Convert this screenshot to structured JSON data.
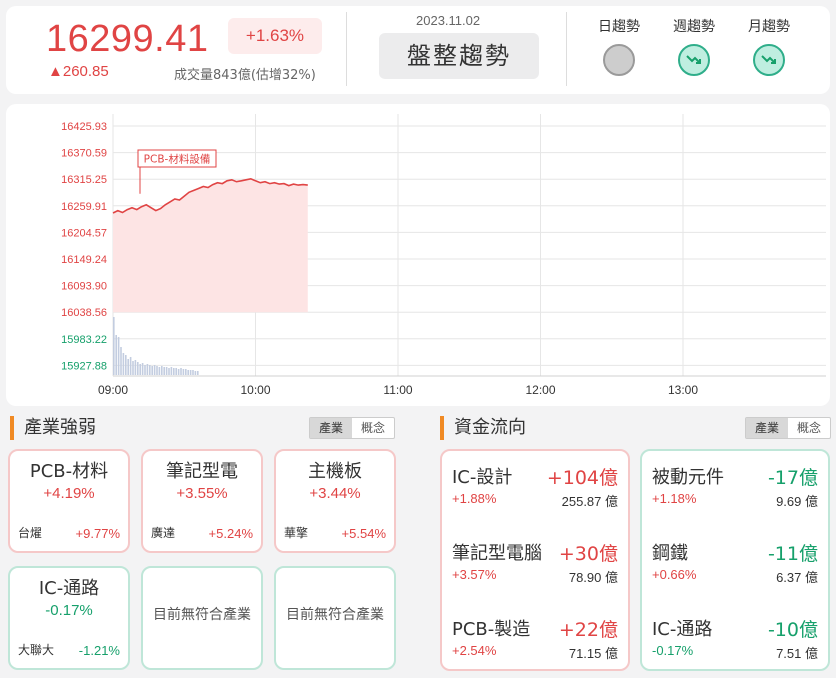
{
  "header": {
    "index_value": "16299.41",
    "pct_change": "+1.63%",
    "point_change": "▲260.85",
    "volume": "成交量843億(估增32%)",
    "date": "2023.11.02",
    "trend_label": "盤整趨勢",
    "trends": [
      {
        "label": "日趨勢",
        "state": "neutral",
        "icon": "neutral-circle-icon"
      },
      {
        "label": "週趨勢",
        "state": "down",
        "icon": "trend-down-icon"
      },
      {
        "label": "月趨勢",
        "state": "down",
        "icon": "trend-down-icon"
      }
    ]
  },
  "chart_data": {
    "type": "line",
    "y_ticks": [
      "16425.93",
      "16370.59",
      "16315.25",
      "16259.91",
      "16204.57",
      "16149.24",
      "16093.90",
      "16038.56",
      "15983.22",
      "15927.88"
    ],
    "y_tick_colors": [
      "#e04444",
      "#e04444",
      "#e04444",
      "#e04444",
      "#e04444",
      "#e04444",
      "#e04444",
      "#e04444",
      "#16a06b",
      "#16a06b"
    ],
    "x_ticks": [
      "09:00",
      "10:00",
      "11:00",
      "12:00",
      "13:00"
    ],
    "ylim": [
      15927.88,
      16425.93
    ],
    "x_range_minutes": [
      0,
      300
    ],
    "annotation": "PCB-材料設備",
    "price_series": {
      "minutes": [
        0,
        2,
        4,
        6,
        8,
        10,
        12,
        14,
        16,
        18,
        20,
        22,
        24,
        26,
        28,
        30,
        32,
        34,
        36,
        38,
        40,
        42,
        44,
        46,
        48,
        50,
        52,
        54,
        56,
        58,
        60,
        62,
        64,
        66,
        68,
        70,
        72,
        74,
        76,
        78,
        80,
        82
      ],
      "values": [
        16245,
        16250,
        16246,
        16252,
        16256,
        16252,
        16258,
        16262,
        16256,
        16250,
        16254,
        16262,
        16268,
        16274,
        16272,
        16280,
        16288,
        16292,
        16296,
        16300,
        16298,
        16304,
        16308,
        16306,
        16312,
        16314,
        16310,
        16312,
        16314,
        16316,
        16312,
        16308,
        16310,
        16306,
        16308,
        16305,
        16306,
        16302,
        16305,
        16303,
        16304,
        16303
      ]
    },
    "volume_bars": [
      58,
      40,
      38,
      28,
      22,
      20,
      16,
      18,
      14,
      15,
      13,
      11,
      12,
      10,
      11,
      10,
      9,
      10,
      9,
      8,
      9,
      8,
      8,
      7,
      8,
      7,
      7,
      6,
      7,
      6,
      6,
      5,
      5,
      5,
      4,
      4
    ],
    "colors": {
      "line": "#e04444",
      "area": "#fde4e4",
      "volume": "#c3cde0",
      "grid": "#e6e6e6"
    }
  },
  "industry": {
    "title": "產業強弱",
    "toggle": [
      "產業",
      "概念"
    ],
    "cards": [
      {
        "name": "PCB-材料",
        "pct": "+4.19%",
        "stock": "台燿",
        "stock_pct": "+9.77%",
        "trend": "up"
      },
      {
        "name": "筆記型電",
        "pct": "+3.55%",
        "stock": "廣達",
        "stock_pct": "+5.24%",
        "trend": "up"
      },
      {
        "name": "主機板",
        "pct": "+3.44%",
        "stock": "華擎",
        "stock_pct": "+5.54%",
        "trend": "up"
      },
      {
        "name": "IC-通路",
        "pct": "-0.17%",
        "stock": "大聯大",
        "stock_pct": "-1.21%",
        "trend": "down"
      }
    ],
    "empty_text": "目前無符合產業"
  },
  "fundflow": {
    "title": "資金流向",
    "toggle": [
      "產業",
      "概念"
    ],
    "inflow": [
      {
        "name": "IC-設計",
        "amount": "+104億",
        "pct": "+1.88%",
        "vol": "255.87 億"
      },
      {
        "name": "筆記型電腦",
        "amount": "+30億",
        "pct": "+3.57%",
        "vol": "78.90 億"
      },
      {
        "name": "PCB-製造",
        "amount": "+22億",
        "pct": "+2.54%",
        "vol": "71.15 億"
      }
    ],
    "outflow": [
      {
        "name": "被動元件",
        "amount": "-17億",
        "pct": "+1.18%",
        "vol": "9.69 億",
        "pct_trend": "up"
      },
      {
        "name": "鋼鐵",
        "amount": "-11億",
        "pct": "+0.66%",
        "vol": "6.37 億",
        "pct_trend": "up"
      },
      {
        "name": "IC-通路",
        "amount": "-10億",
        "pct": "-0.17%",
        "vol": "7.51 億",
        "pct_trend": "down"
      }
    ]
  }
}
